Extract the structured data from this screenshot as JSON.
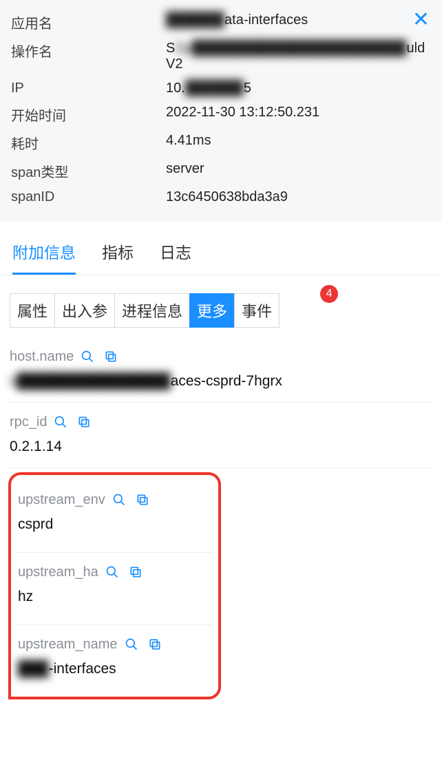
{
  "header": {
    "close": "✕",
    "rows": [
      {
        "label": "应用名",
        "value_prefix": "██████",
        "value_suffix": "ata-interfaces"
      },
      {
        "label": "操作名",
        "value_prefix": "Sp██████████████████████",
        "value_suffix": "uldV2"
      },
      {
        "label": "IP",
        "value_prefix": "10.",
        "value_mid": "██████",
        "value_suffix": "5"
      },
      {
        "label": "开始时间",
        "value": "2022-11-30 13:12:50.231"
      },
      {
        "label": "耗时",
        "value": "4.41ms"
      },
      {
        "label": "span类型",
        "value": "server"
      },
      {
        "label": "spanID",
        "value": "13c6450638bda3a9"
      }
    ]
  },
  "primary_tabs": {
    "items": [
      {
        "label": "附加信息",
        "active": true
      },
      {
        "label": "指标",
        "active": false
      },
      {
        "label": "日志",
        "active": false
      }
    ]
  },
  "segment_tabs": {
    "items": [
      {
        "label": "属性",
        "active": false
      },
      {
        "label": "出入参",
        "active": false
      },
      {
        "label": "进程信息",
        "active": false
      },
      {
        "label": "更多",
        "active": true
      },
      {
        "label": "事件",
        "active": false
      }
    ],
    "badge": "4"
  },
  "attributes": {
    "plain": [
      {
        "key": "host.name",
        "value_prefix": "s███████████████",
        "value_suffix": "aces-csprd-7hgrx"
      },
      {
        "key": "rpc_id",
        "value": "0.2.1.14"
      }
    ],
    "highlighted": [
      {
        "key": "upstream_env",
        "value": "csprd"
      },
      {
        "key": "upstream_ha",
        "value": "hz"
      },
      {
        "key": "upstream_name",
        "value_prefix": "███",
        "value_suffix": "-interfaces"
      }
    ]
  }
}
